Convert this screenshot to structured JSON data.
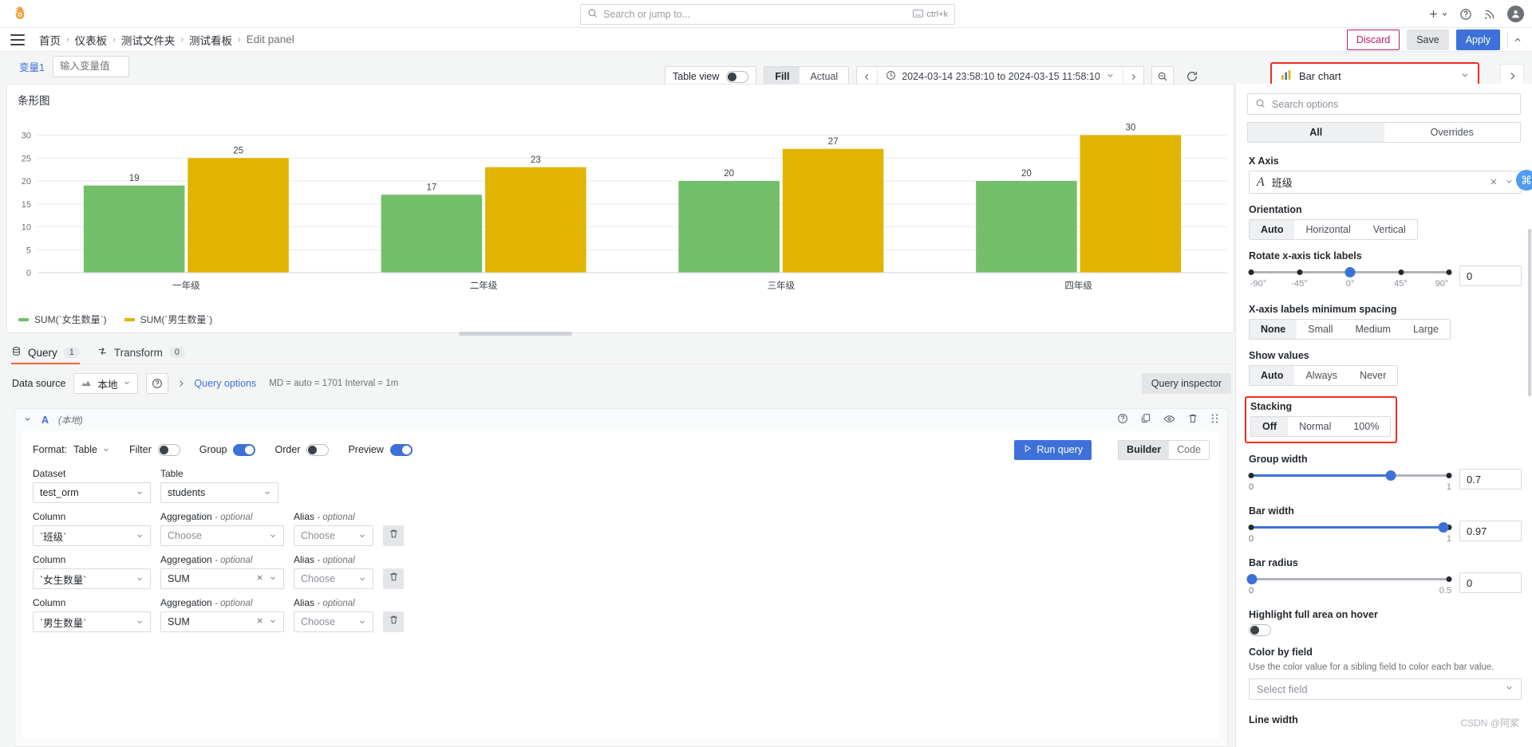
{
  "topnav": {
    "logo_icon": "grafana-logo-icon",
    "search_placeholder": "Search or jump to...",
    "search_icon": "search-icon",
    "kbd_icon": "keyboard-icon",
    "kbd_hint": "ctrl+k",
    "plus_icon": "plus-icon",
    "help_icon": "help-circle-icon",
    "news_icon": "rss-icon",
    "avatar_icon": "user-avatar"
  },
  "breadcrumb": {
    "menu_icon": "hamburger-menu-icon",
    "items": [
      {
        "label": "首页"
      },
      {
        "label": "仪表板"
      },
      {
        "label": "测试文件夹"
      },
      {
        "label": "测试看板"
      },
      {
        "label": "Edit panel"
      }
    ],
    "separator": "›",
    "discard_label": "Discard",
    "save_label": "Save",
    "apply_label": "Apply",
    "caret_icon": "chevron-up-icon"
  },
  "toolbar": {
    "variable_label": "变量1",
    "variable_placeholder": "输入变量值",
    "variable_value": "",
    "table_view_label": "Table view",
    "table_view_on": false,
    "fill_label": "Fill",
    "actual_label": "Actual",
    "fill_active": true,
    "prev_icon": "chevron-left-icon",
    "clock_icon": "clock-icon",
    "time_range": "2024-03-14 23:58:10 to 2024-03-15 11:58:10",
    "time_caret_icon": "chevron-down-icon",
    "next_icon": "chevron-right-icon",
    "zoom_out_icon": "zoom-out-icon",
    "refresh_icon": "refresh-icon",
    "viz_icon": "bar-chart-icon",
    "viz_name": "Bar chart",
    "viz_caret_icon": "chevron-down-icon",
    "viz_next_icon": "chevron-right-icon"
  },
  "panel": {
    "title": "条形图",
    "scrollbar": "horizontal-scrollbar"
  },
  "chart_data": {
    "type": "bar",
    "title": "条形图",
    "categories": [
      "一年级",
      "二年级",
      "三年级",
      "四年级"
    ],
    "series": [
      {
        "name": "SUM(`女生数量`)",
        "color": "#73bf69",
        "values": [
          19,
          17,
          20,
          20
        ]
      },
      {
        "name": "SUM(`男生数量`)",
        "color": "#e0b400",
        "values": [
          25,
          23,
          27,
          30
        ]
      }
    ],
    "xlabel": "",
    "ylabel": "",
    "ylim": [
      0,
      32
    ],
    "yticks": [
      0,
      5,
      10,
      15,
      20,
      25,
      30
    ],
    "grid": true,
    "legend_position": "bottom-left",
    "show_values": true
  },
  "query": {
    "tabs": [
      {
        "label": "Query",
        "count": "1",
        "icon": "database-icon",
        "active": true
      },
      {
        "label": "Transform",
        "count": "0",
        "icon": "transform-icon",
        "active": false
      }
    ],
    "data_source_label": "Data source",
    "data_source_value": "本地",
    "data_source_icon": "datasource-icon",
    "help_icon": "help-circle-icon",
    "expand_icon": "chevron-right-icon",
    "query_options_label": "Query options",
    "query_meta": "MD = auto = 1701      Interval = 1m",
    "query_inspector_label": "Query inspector",
    "refid": "A",
    "refid_datasource": "(本地)",
    "collapse_icon": "chevron-down-icon",
    "row_icons": [
      "help-circle-icon",
      "duplicate-icon",
      "eye-icon",
      "trash-icon",
      "drag-handle-icon"
    ],
    "format_label": "Format:",
    "format_value": "Table",
    "filter_label": "Filter",
    "filter_on": false,
    "group_label": "Group",
    "group_on": true,
    "order_label": "Order",
    "order_on": false,
    "preview_label": "Preview",
    "preview_on": true,
    "run_query_label": "Run query",
    "run_icon": "play-icon",
    "builder_label": "Builder",
    "code_label": "Code",
    "builder_active": true,
    "dataset_label": "Dataset",
    "dataset_value": "test_orm",
    "table_label": "Table",
    "table_value": "students",
    "column_label": "Column",
    "aggregation_label": "Aggregation",
    "alias_label": "Alias",
    "optional_suffix": "- optional",
    "choose_placeholder": "Choose",
    "trash_icon": "trash-icon",
    "rows": [
      {
        "column": "`班级`",
        "aggregation": "Choose",
        "agg_is_placeholder": true,
        "alias": "Choose"
      },
      {
        "column": "`女生数量`",
        "aggregation": "SUM",
        "agg_is_placeholder": false,
        "alias": "Choose"
      },
      {
        "column": "`男生数量`",
        "aggregation": "SUM",
        "agg_is_placeholder": false,
        "alias": "Choose"
      }
    ]
  },
  "options": {
    "search_placeholder": "Search options",
    "search_icon": "search-icon",
    "tab_all": "All",
    "tab_overrides": "Overrides",
    "x_axis_label": "X Axis",
    "x_axis_value": "班级",
    "x_axis_type_icon": "text-field-icon",
    "x_axis_clear_icon": "close-icon",
    "x_axis_caret_icon": "chevron-down-icon",
    "orientation_label": "Orientation",
    "orientation_options": [
      "Auto",
      "Horizontal",
      "Vertical"
    ],
    "orientation_value": "Auto",
    "rotate_label": "Rotate x-axis tick labels",
    "rotate_ticks": [
      "-90°",
      "-45°",
      "0°",
      "45°",
      "90°"
    ],
    "rotate_value": "0",
    "spacing_label": "X-axis labels minimum spacing",
    "spacing_options": [
      "None",
      "Small",
      "Medium",
      "Large"
    ],
    "spacing_value": "None",
    "show_values_label": "Show values",
    "show_values_options": [
      "Auto",
      "Always",
      "Never"
    ],
    "show_values_value": "Auto",
    "stacking_label": "Stacking",
    "stacking_options": [
      "Off",
      "Normal",
      "100%"
    ],
    "stacking_value": "Off",
    "group_width_label": "Group width",
    "group_width_value": "0.7",
    "group_width_min": "0",
    "group_width_max": "1",
    "bar_width_label": "Bar width",
    "bar_width_value": "0.97",
    "bar_width_min": "0",
    "bar_width_max": "1",
    "bar_radius_label": "Bar radius",
    "bar_radius_value": "0",
    "bar_radius_min": "0",
    "bar_radius_max": "0.5",
    "highlight_label": "Highlight full area on hover",
    "highlight_on": false,
    "color_by_field_label": "Color by field",
    "color_by_field_hint": "Use the color value for a sibling field to color each bar value.",
    "select_field_placeholder": "Select field",
    "line_width_label": "Line width",
    "watermark": "CSDN @阿桨"
  }
}
